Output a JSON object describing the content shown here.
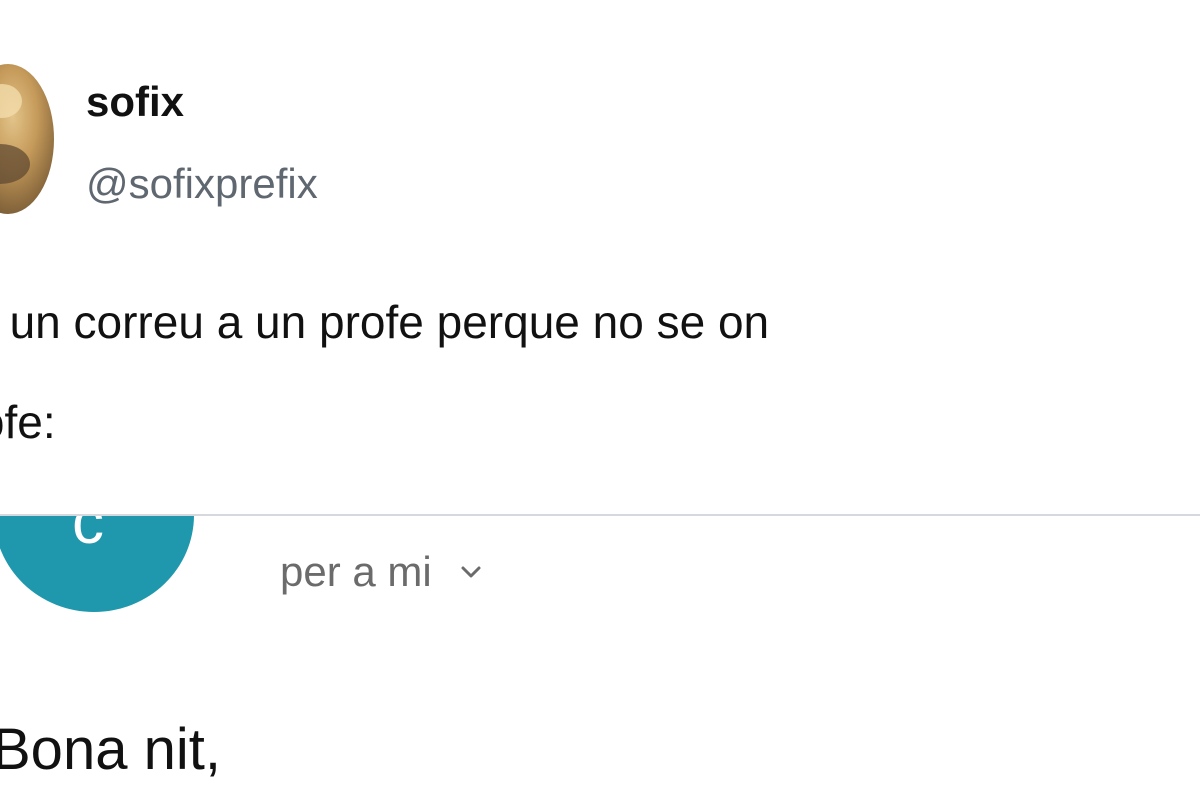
{
  "tweet": {
    "display_name": "sofix",
    "handle": "@sofixprefix",
    "text_line1": "vio un correu a un profe perque no se on",
    "text_line2": "profe:"
  },
  "email": {
    "sender_initial": "c",
    "recipient_label": "per a mi",
    "body_greeting": "Bona nit,",
    "avatar_color": "#1f98ad",
    "chevron_icon": "chevron-down-icon"
  }
}
